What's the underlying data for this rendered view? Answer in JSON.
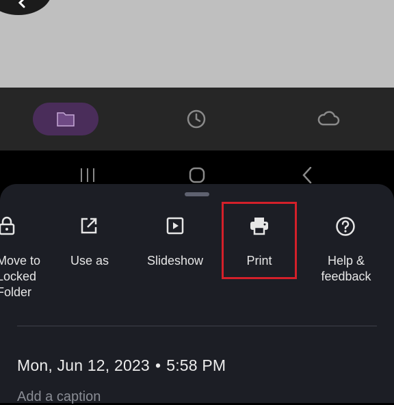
{
  "sheet": {
    "actions": [
      {
        "id": "locked",
        "label_lines": [
          "Move to",
          "Locked",
          "Folder"
        ],
        "icon": "lock-icon"
      },
      {
        "id": "use-as",
        "label": "Use as",
        "icon": "open-external-icon"
      },
      {
        "id": "slideshow",
        "label": "Slideshow",
        "icon": "slideshow-icon"
      },
      {
        "id": "print",
        "label": "Print",
        "icon": "printer-icon"
      },
      {
        "id": "help",
        "label_lines": [
          "Help &",
          "feedback"
        ],
        "icon": "help-icon"
      }
    ],
    "date": "Mon, Jun 12, 2023",
    "time": "5:58 PM",
    "separator": "•",
    "peek_text": "Add a caption"
  },
  "nav": {
    "items": [
      {
        "id": "files",
        "icon": "folder-icon",
        "active": true
      },
      {
        "id": "recent",
        "icon": "clock-icon"
      },
      {
        "id": "cloud",
        "icon": "cloud-icon"
      }
    ]
  },
  "colors": {
    "sheet_bg": "#1c1e25",
    "nav_bg": "#262626",
    "active_pill": "#4a2d5a",
    "highlight": "#d4202a",
    "text": "#e6e6e6"
  }
}
